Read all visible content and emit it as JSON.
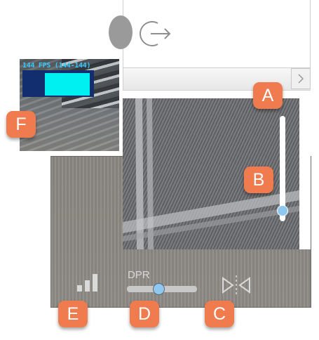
{
  "fps_overlay": {
    "text": "144 FPS (144-144)"
  },
  "dpr": {
    "label": "DPR",
    "value": 0.45
  },
  "zoom_slider": {
    "value": 0.9
  },
  "icons": {
    "logout": "logout-icon",
    "scroll_right": "chevron-right-icon",
    "bars": "signal-bars-icon",
    "compare": "compare-split-icon"
  },
  "callouts": {
    "a": "A",
    "b": "B",
    "c": "C",
    "d": "D",
    "e": "E",
    "f": "F"
  },
  "colors": {
    "callout": "#ef7b4f",
    "slider_thumb": "#8ec8ee",
    "fps_text": "#35c8ff",
    "fps_bar": "#00f0f2",
    "fps_graph_bg": "#122e6e"
  }
}
